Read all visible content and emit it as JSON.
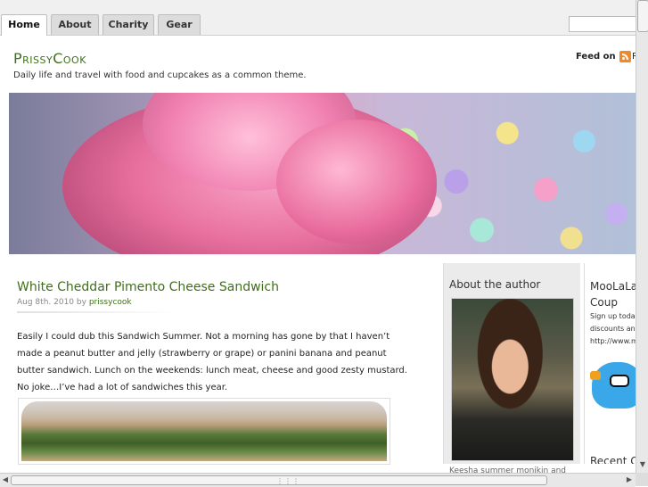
{
  "nav": {
    "tabs": [
      {
        "label": "Home"
      },
      {
        "label": "About"
      },
      {
        "label": "Charity"
      },
      {
        "label": "Gear"
      }
    ]
  },
  "header": {
    "site_title": "PrissyCook",
    "tagline": "Daily life and travel with food and cupcakes as a common theme.",
    "feed_label": "Feed on",
    "feed_rest": "R"
  },
  "post": {
    "title": "White Cheddar Pimento Cheese Sandwich",
    "date": "Aug 8th. 2010",
    "by": "by",
    "author": "prissycook",
    "body": "Easily I could dub this Sandwich Summer. Not a morning has gone by that I haven’t made a peanut butter and jelly (strawberry or grape) or panini banana and peanut butter sandwich. Lunch on the weekends: lunch meat, cheese and good zesty mustard. No joke…I’ve had a lot of sandwiches this year."
  },
  "sidebar": {
    "about_title": "About the author",
    "about_footer": "Keesha summer monikin and",
    "ad_title": "MooLaLa and Coup",
    "ad_text": "Sign up toda discounts an http://www.m",
    "recent_title": "Recent C"
  },
  "icons": {
    "rss": "rss-feed-icon",
    "mascot": "bird-mascot-icon"
  },
  "colors": {
    "title_green": "#3f6f1a",
    "rss_orange": "#f08a24",
    "sidebar_bg": "#ebebeb"
  }
}
